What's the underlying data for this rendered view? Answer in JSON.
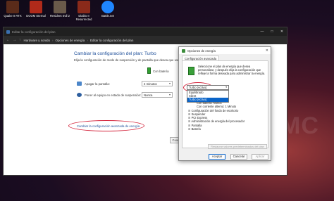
{
  "desktop": {
    "icons": [
      {
        "label": "Quake II RTX",
        "color": "#5a2b1a"
      },
      {
        "label": "DOOM Eternal",
        "color": "#b02a1a"
      },
      {
        "label": "Resident Evil 2",
        "color": "#6a5a4a"
      },
      {
        "label": "Diablo II Resurrected",
        "color": "#8a2a1a"
      },
      {
        "label": "Battle.net",
        "color": "#1f86ff"
      }
    ],
    "watermark": "MC"
  },
  "window": {
    "title": "Editar la configuración del plan",
    "controls": {
      "minimize": "—",
      "maximize": "□",
      "close": "✕"
    },
    "address": {
      "nav": {
        "back": "←",
        "forward": "→",
        "up": "↑"
      },
      "crumbs": [
        "Hardware y sonido",
        "Opciones de energía",
        "Editar la configuración del plan"
      ],
      "separator": "›"
    },
    "heading": "Cambiar la configuración del plan: Turbo",
    "subheading": "Elija la configuración de modo de suspensión y de pantalla que desea que use su equipo.",
    "battery_label": "Con batería",
    "rows": [
      {
        "label": "Apagar la pantalla:",
        "value": "2 minutos"
      },
      {
        "label": "Poner al equipo en estado de suspensión:",
        "value": "Nunca"
      }
    ],
    "advanced_link": "Cambiar la configuración avanzada de energía",
    "save_button": "Guardar"
  },
  "dialog": {
    "title": "Opciones de energía",
    "close": "✕",
    "tab": "Configuración avanzada",
    "description": "Seleccione el plan de energía que desea personalizar, y después elija la configuración que refleje la forma deseada para administrar la energía.",
    "selected_plan": "Turbo [Activo]",
    "plan_options": [
      "Equilibrado",
      "Silent",
      "Turbo [Activo]"
    ],
    "tree": [
      {
        "pm": "",
        "text": "Con batería: Nunca"
      },
      {
        "pm": "",
        "text": "Con corriente alterna: 1 Minuto"
      },
      {
        "pm": "⊞",
        "text": "Configuración del fondo de escritorio"
      },
      {
        "pm": "⊞",
        "text": "Suspender"
      },
      {
        "pm": "⊞",
        "text": "PCI Express"
      },
      {
        "pm": "⊞",
        "text": "Administración de energía del procesador"
      },
      {
        "pm": "⊞",
        "text": "Pantalla"
      },
      {
        "pm": "⊞",
        "text": "Batería"
      }
    ],
    "restore_button": "Restaurar valores predeterminados del plan",
    "buttons": {
      "ok": "Aceptar",
      "cancel": "Cancelar",
      "apply": "Aplicar"
    }
  },
  "colors": {
    "accent": "#0a64c8",
    "highlight_circle": "#d3223a",
    "link": "#1e4f9a"
  }
}
